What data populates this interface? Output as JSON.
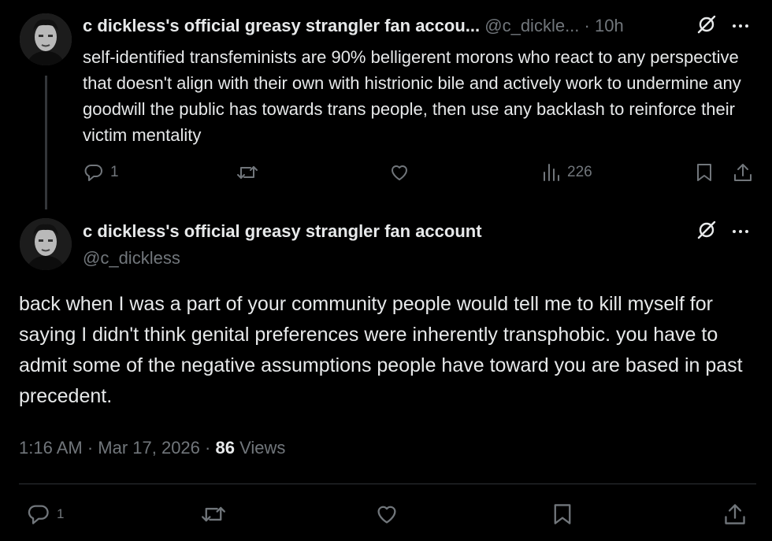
{
  "reply": {
    "display_name": "c dickless's official greasy strangler fan accou...",
    "handle": "@c_dickle...",
    "separator": "·",
    "time": "10h",
    "text": "self-identified transfeminists are 90% belligerent morons who react to any perspective that doesn't align with their own with histrionic bile and actively work to undermine any goodwill the public has towards trans people, then use any backlash to reinforce their victim mentality",
    "reply_count": "1",
    "view_count": "226"
  },
  "main": {
    "display_name": "c dickless's official greasy strangler fan account",
    "handle": "@c_dickless",
    "text": "back when I was a part of your community people would tell me to kill myself for saying I didn't think genital preferences were inherently transphobic. you have to admit some of the negative assumptions people have toward you are based in past precedent.",
    "timestamp": "1:16 AM · Mar 17, 2026 ·",
    "views_count": "86",
    "views_label": "Views",
    "reply_count": "1"
  },
  "icons": {
    "reply": "reply-icon",
    "retweet": "retweet-icon",
    "like": "heart-icon",
    "views": "views-icon",
    "bookmark": "bookmark-icon",
    "share": "share-icon",
    "grok": "grok-icon",
    "more": "more-icon"
  },
  "colors": {
    "background": "#000000",
    "text": "#e7e9ea",
    "muted": "#71767b",
    "divider": "#2f3336"
  }
}
